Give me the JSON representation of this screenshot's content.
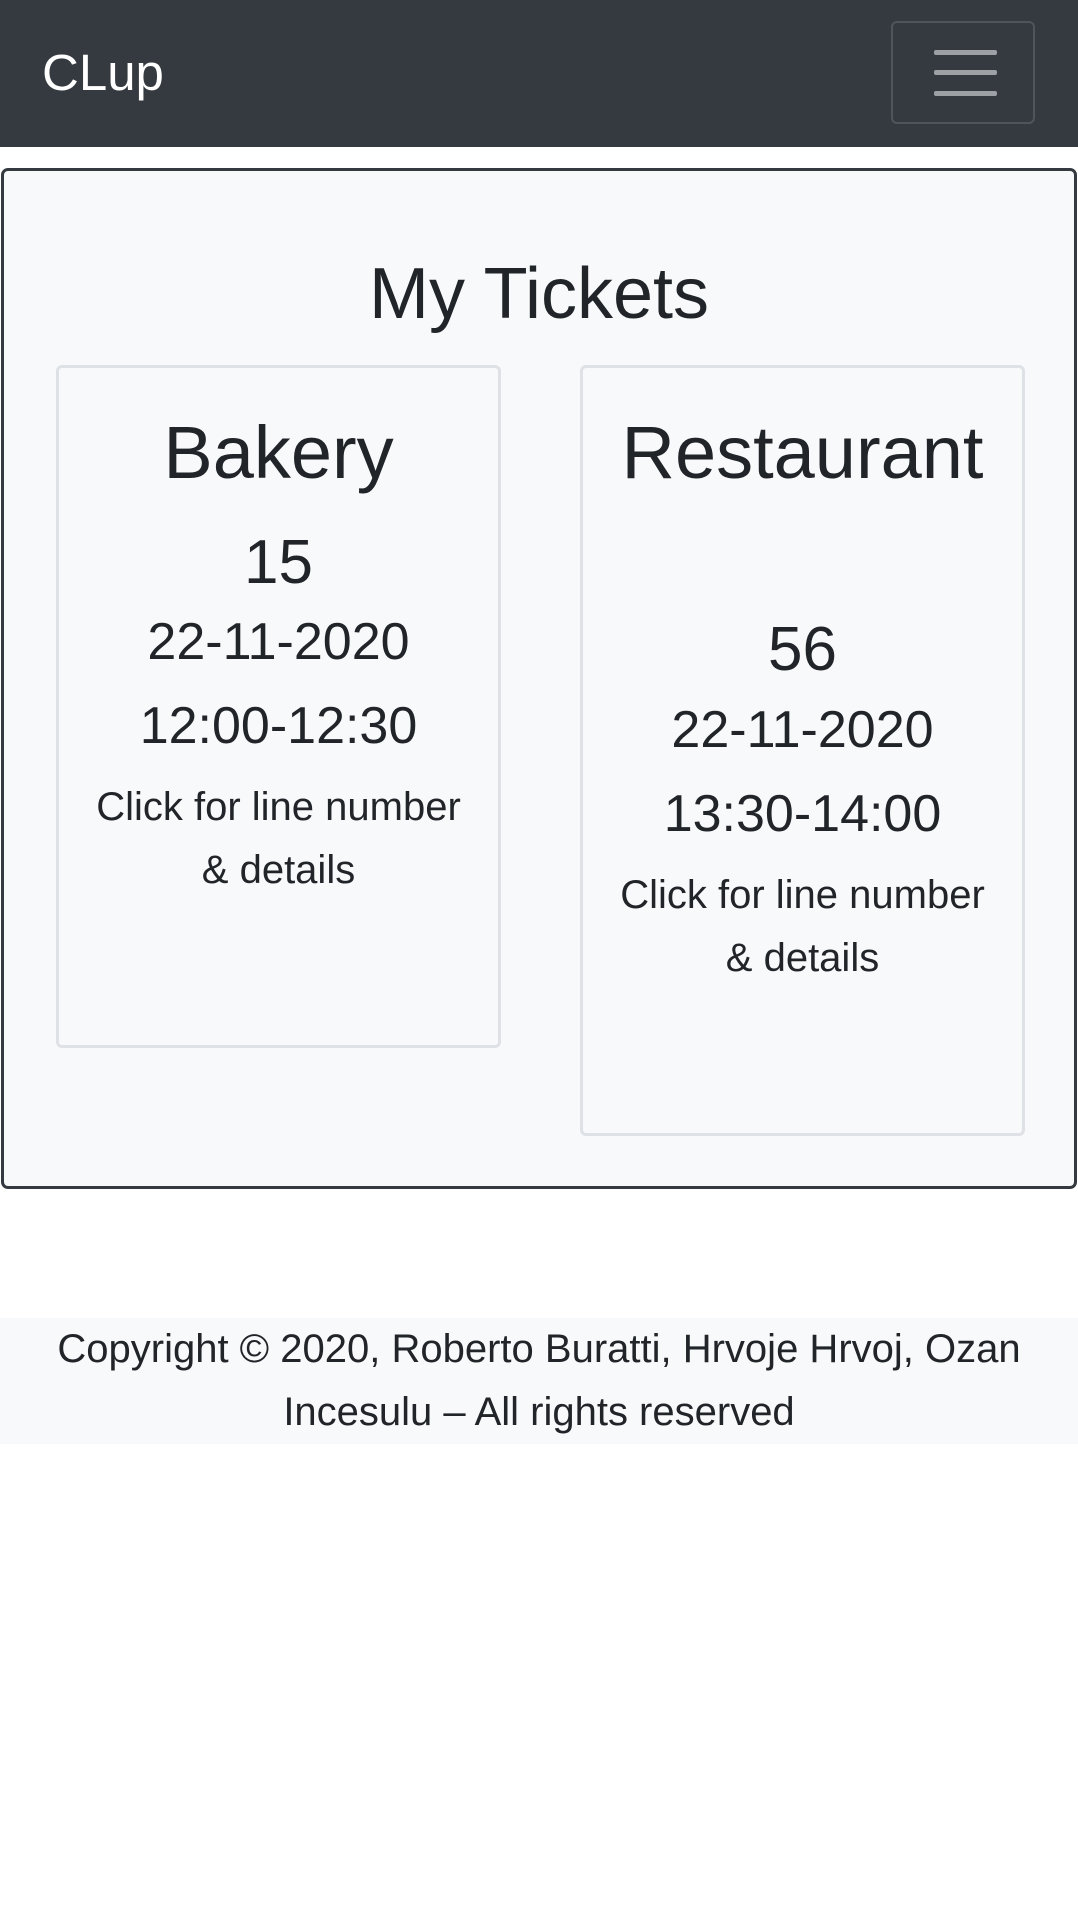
{
  "navbar": {
    "brand": "CLup",
    "toggler_icon": "hamburger-menu-icon"
  },
  "main": {
    "title": "My Tickets",
    "tickets": [
      {
        "store": "Bakery",
        "number": "15",
        "date": "22-11-2020",
        "time": "12:00-12:30",
        "hint": "Click for line number & details"
      },
      {
        "store": "Restaurant",
        "number": "56",
        "date": "22-11-2020",
        "time": "13:30-14:00",
        "hint": "Click for line number & details"
      }
    ]
  },
  "footer": {
    "text": "Copyright © 2020, Roberto Buratti, Hrvoje Hrvoj, Ozan Incesulu – All rights reserved"
  },
  "colors": {
    "navbar_bg": "#343a40",
    "card_bg": "#f8f9fa",
    "text": "#212529"
  }
}
